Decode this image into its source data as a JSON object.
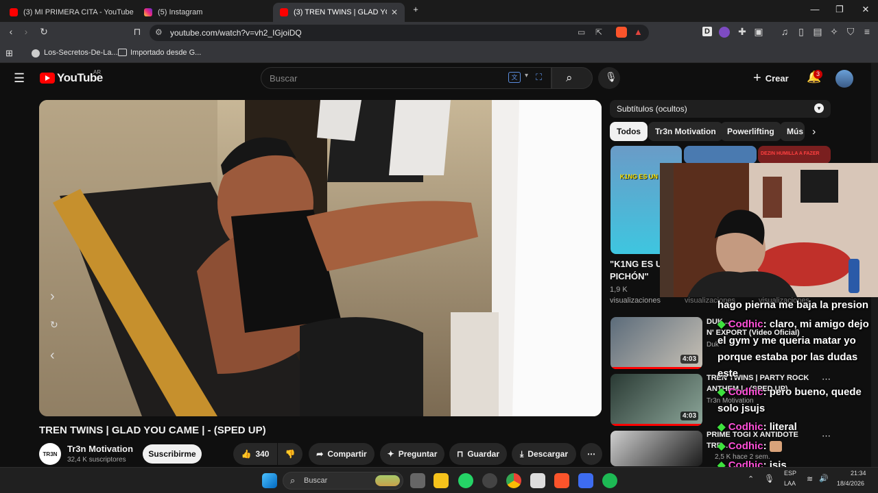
{
  "browser": {
    "tabs": [
      {
        "title": "(3) MI PRIMERA CITA - YouTube"
      },
      {
        "title": "(5) Instagram"
      },
      {
        "title": "(3) TREN TWINS | GLAD YOU CA"
      }
    ],
    "new_tab": "+",
    "url": "youtube.com/watch?v=vh2_IGjoiDQ",
    "bookmarks": [
      {
        "label": "Los-Secretos-De-La..."
      },
      {
        "label": "Importado desde G..."
      }
    ]
  },
  "youtube": {
    "logo_text": "YouTube",
    "region": "AR",
    "search_placeholder": "Buscar",
    "create_label": "Crear",
    "notif_count": "3",
    "video": {
      "title": "TREN TWINS | GLAD YOU CAME | - (SPED UP)",
      "channel": "Tr3n Motivation",
      "channel_avatar": "TR3N",
      "subscribers": "32,4 K suscriptores",
      "subscribe_label": "Suscribirme",
      "likes": "340",
      "share_label": "Compartir",
      "ask_label": "Preguntar",
      "save_label": "Guardar",
      "download_label": "Descargar"
    },
    "subtitles_label": "Subtítulos (ocultos)",
    "chips": [
      "Todos",
      "Tr3n Motivation",
      "Powerlifting",
      "Mús"
    ],
    "sidebar": {
      "short_title_1": "\"K1NG ES UN",
      "short_title_2": "PICHÓN\"",
      "short_views_1": "1,9 K",
      "short_views_2": "visualizaciones",
      "short_views_3": "visualizaciones",
      "short_views_4": "visualizaciones",
      "thumb_text_1": "K1NG ES UN PIC",
      "thumb_text_2": "DEZIN HUMILLA A FAZER",
      "items": [
        {
          "title_1": "DUK...",
          "title_2": "N' EXPORT (Video Oficial)",
          "channel": "Duk",
          "duration": "4:03"
        },
        {
          "title_1": "TREN TWINS | PARTY ROCK",
          "title_2": "ANTHEM | - (SPED UP)",
          "channel": "Tr3n Motivation",
          "duration": "4:03"
        },
        {
          "title_1": "PRIME TOGI X ANTIDOTE",
          "title_2": "TRE...",
          "channel": "2,5 K   hace 2 sem."
        }
      ]
    }
  },
  "chat": [
    {
      "user": "",
      "text": "hago pierna me baja la presion"
    },
    {
      "user": "Codhic",
      "text": ": claro, mi amigo dejo"
    },
    {
      "user": "",
      "text": "el gym y me queria matar yo"
    },
    {
      "user": "",
      "text": "porque estaba por las dudas"
    },
    {
      "user": "",
      "text": "este"
    },
    {
      "user": "Codhic",
      "text": ": pero bueno, quede"
    },
    {
      "user": "",
      "text": "solo jsujs"
    },
    {
      "user": "Codhic",
      "text": ": literal"
    },
    {
      "user": "Codhic",
      "text": ":"
    },
    {
      "user": "Codhic",
      "text": ": jsjs"
    }
  ],
  "taskbar": {
    "search_placeholder": "Buscar",
    "lang_1": "ESP",
    "lang_2": "LAA",
    "time": "21:34",
    "date": "18/4/2026"
  },
  "colors": {
    "youtube_red": "#ff0000",
    "chat_user": "#ff4fd8",
    "chat_diamond": "#3ee03e",
    "bg": "#0f0f0f"
  }
}
